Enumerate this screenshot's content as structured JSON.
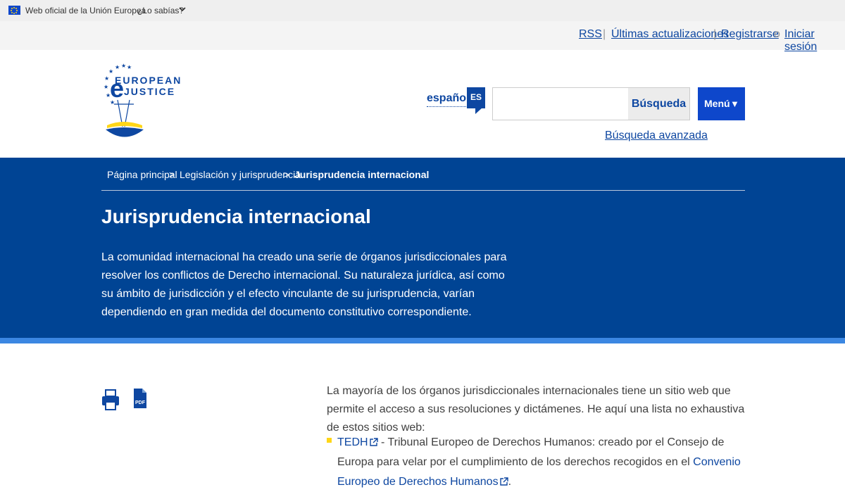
{
  "eu_bar": {
    "official_text": "Web oficial de la Unión Europea",
    "know_text": "¿Lo sabías?",
    "chevron": "⌄"
  },
  "top_links": {
    "rss": "RSS",
    "sep1": "|",
    "updates": "Últimas actualizaciones",
    "sep2": "|",
    "register": "Registrarse",
    "or": "o",
    "login": "Iniciar sesión"
  },
  "header": {
    "logo_line1": "EUROPEAN",
    "logo_line2": "JUSTICE",
    "language": "español",
    "language_code": "ES",
    "search_value": "",
    "search_button": "Búsqueda",
    "menu_button": "Menú",
    "menu_arrow": "▼",
    "advanced_search": "Búsqueda avanzada"
  },
  "breadcrumb": {
    "home": "Página principal",
    "section": "Legislación y jurisprudencia",
    "current": "Jurisprudencia internacional",
    "separator": ">"
  },
  "banner": {
    "title": "Jurisprudencia internacional",
    "intro": "La comunidad internacional ha creado una serie de órganos jurisdiccionales para resolver los conflictos de Derecho internacional. Su naturaleza jurídica, así como su ámbito de jurisdicción y el efecto vinculante de su jurisprudencia, varían dependiendo en gran medida del documento constitutivo correspondiente."
  },
  "tools": {
    "print_icon": "print-icon",
    "pdf_icon": "pdf-icon",
    "pdf_label": "PDF"
  },
  "content": {
    "paragraph": "La mayoría de los órganos jurisdiccionales internacionales tiene un sitio web que permite el acceso a sus resoluciones y dictámenes. He aquí una lista no exhaustiva de estos sitios web:",
    "items": [
      {
        "link": "TEDH",
        "text_before": " - Tribunal Europeo de Derechos Humanos: creado por el Consejo de Europa para velar por el cumplimiento de los derechos recogidos en el ",
        "link2": "Convenio Europeo de Derechos Humanos",
        "text_after": "."
      }
    ]
  },
  "colors": {
    "primary_blue": "#004494",
    "link_blue": "#0e47a1",
    "menu_blue": "#0e47cb",
    "accent_yellow": "#ffd617",
    "strip_blue": "#3b87e2"
  }
}
